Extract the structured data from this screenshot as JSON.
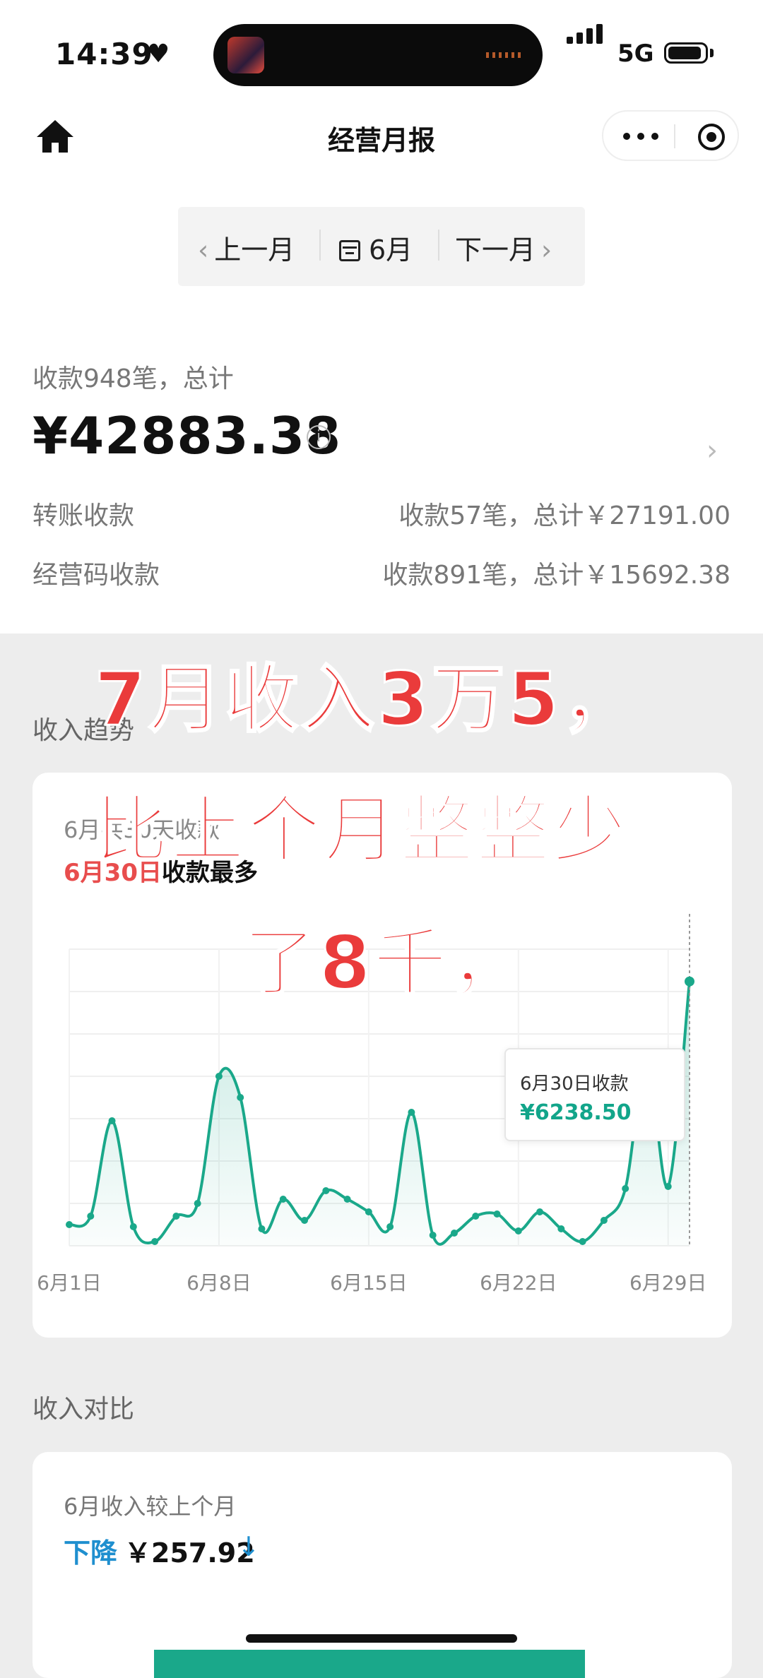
{
  "status": {
    "time": "14:39",
    "network": "5G"
  },
  "nav": {
    "title": "经营月报"
  },
  "month": {
    "prev": "上一月",
    "current": "6月",
    "next": "下一月"
  },
  "summary": {
    "label": "收款948笔，总计",
    "amount": "¥42883.38",
    "rows": [
      {
        "label": "转账收款",
        "value": "收款57笔，总计￥27191.00"
      },
      {
        "label": "经营码收款",
        "value": "收款891笔，总计￥15692.38"
      }
    ]
  },
  "overlay": {
    "line1": "7月收入3万5，",
    "line2": "比上个月整整少",
    "line3": "了8千，"
  },
  "trend": {
    "title": "收入趋势",
    "subtitle": "6月共30天收款",
    "highlight_date": "6月30日",
    "highlight_text": "收款最多",
    "tooltip_label": "6月30日收款",
    "tooltip_value": "¥6238.50"
  },
  "chart_data": {
    "type": "area",
    "x": [
      "6月1日",
      "6月2日",
      "6月3日",
      "6月4日",
      "6月5日",
      "6月6日",
      "6月7日",
      "6月8日",
      "6月9日",
      "6月10日",
      "6月11日",
      "6月12日",
      "6月13日",
      "6月14日",
      "6月15日",
      "6月16日",
      "6月17日",
      "6月18日",
      "6月19日",
      "6月20日",
      "6月21日",
      "6月22日",
      "6月23日",
      "6月24日",
      "6月25日",
      "6月26日",
      "6月27日",
      "6月28日",
      "6月29日",
      "6月30日"
    ],
    "values": [
      500,
      700,
      2950,
      450,
      100,
      700,
      1000,
      4000,
      3500,
      400,
      1100,
      600,
      1300,
      1100,
      800,
      450,
      3150,
      250,
      300,
      700,
      750,
      350,
      800,
      400,
      100,
      600,
      1350,
      4400,
      1400,
      6238.5
    ],
    "tick_labels": [
      "6月1日",
      "6月8日",
      "6月15日",
      "6月22日",
      "6月29日"
    ],
    "color": "#1aa88a",
    "grid": true
  },
  "compare": {
    "title": "收入对比",
    "label": "6月收入较上个月",
    "trend": "下降",
    "amount": "￥257.92",
    "arrow": "↓"
  }
}
